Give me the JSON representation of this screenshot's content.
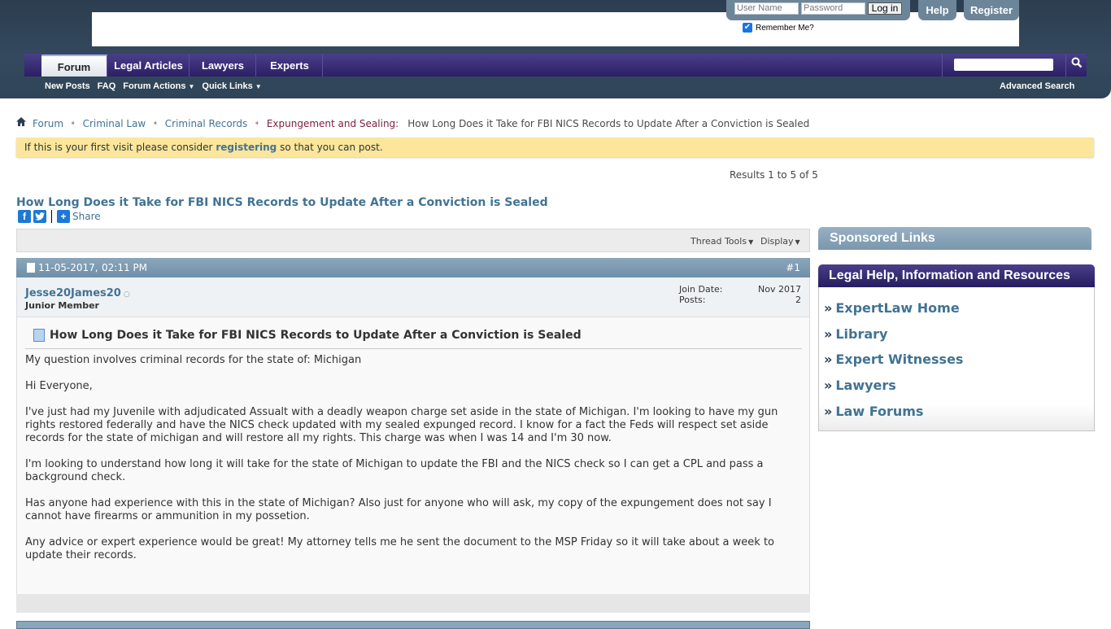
{
  "header": {
    "login": {
      "username_placeholder": "User Name",
      "password_placeholder": "Password",
      "login_button": "Log in",
      "remember_label": "Remember Me?",
      "remember_checked": true
    },
    "help_button": "Help",
    "register_button": "Register",
    "nav_tabs": [
      {
        "label": "Forum",
        "active": true
      },
      {
        "label": "Legal Articles",
        "active": false
      },
      {
        "label": "Lawyers",
        "active": false
      },
      {
        "label": "Experts",
        "active": false
      }
    ],
    "sub_nav": [
      {
        "label": "New Posts"
      },
      {
        "label": "FAQ"
      },
      {
        "label": "Forum Actions",
        "caret": "▼"
      },
      {
        "label": "Quick Links",
        "caret": "▼"
      }
    ],
    "search_placeholder": "",
    "advanced_search": "Advanced Search"
  },
  "breadcrumb": {
    "items": [
      "Forum",
      "Criminal Law",
      "Criminal Records"
    ],
    "current_forum": "Expungement and Sealing:",
    "current_thread": "How Long Does it Take for FBI NICS Records to Update After a Conviction is Sealed"
  },
  "notice": {
    "prefix": "If this is your first visit please consider ",
    "link": "registering",
    "suffix": " so that you can post."
  },
  "results": "Results 1 to 5 of 5",
  "thread": {
    "title": "How Long Does it Take for FBI NICS Records to Update After a Conviction is Sealed",
    "share_label": "Share",
    "tools": {
      "thread_tools": "Thread Tools",
      "display": "Display",
      "caret": "▼"
    }
  },
  "post": {
    "date": "11-05-2017,",
    "time": "02:11 PM",
    "number": "#1",
    "username": "Jesse20James20",
    "user_title": "Junior Member",
    "join_date_label": "Join Date:",
    "join_date": "Nov 2017",
    "posts_label": "Posts:",
    "posts": "2",
    "title": "How Long Does it Take for FBI NICS Records to Update After a Conviction is Sealed",
    "paragraphs": [
      "My question involves criminal records for the state of: Michigan",
      "Hi Everyone,",
      "I've just had my Juvenile with adjudicated Assualt with a deadly weapon charge set aside in the state of Michigan. I'm looking to have my gun rights restored federally and have the NICS check updated with my sealed expunged record. I know for a fact the Feds will respect set aside records for the state of michigan and will restore all my rights. This charge was when I was 14 and I'm 30 now.",
      "I'm looking to understand how long it will take for the state of Michigan to update the FBI and the NICS check so I can get a CPL and pass a background check.",
      "Has anyone had experience with this in the state of Michigan? Also just for anyone who will ask, my copy of the expungement does not say I cannot have firearms or ammunition in my possetion.",
      "Any advice or expert experience would be great! My attorney tells me he sent the document to the MSP Friday so it will take about a week to update their records."
    ]
  },
  "sidebar": {
    "sponsored_title": "Sponsored Links",
    "resources_title": "Legal Help, Information and Resources",
    "bullet": "»",
    "links": [
      "ExpertLaw Home",
      "Library",
      "Expert Witnesses",
      "Lawyers",
      "Law Forums"
    ]
  }
}
